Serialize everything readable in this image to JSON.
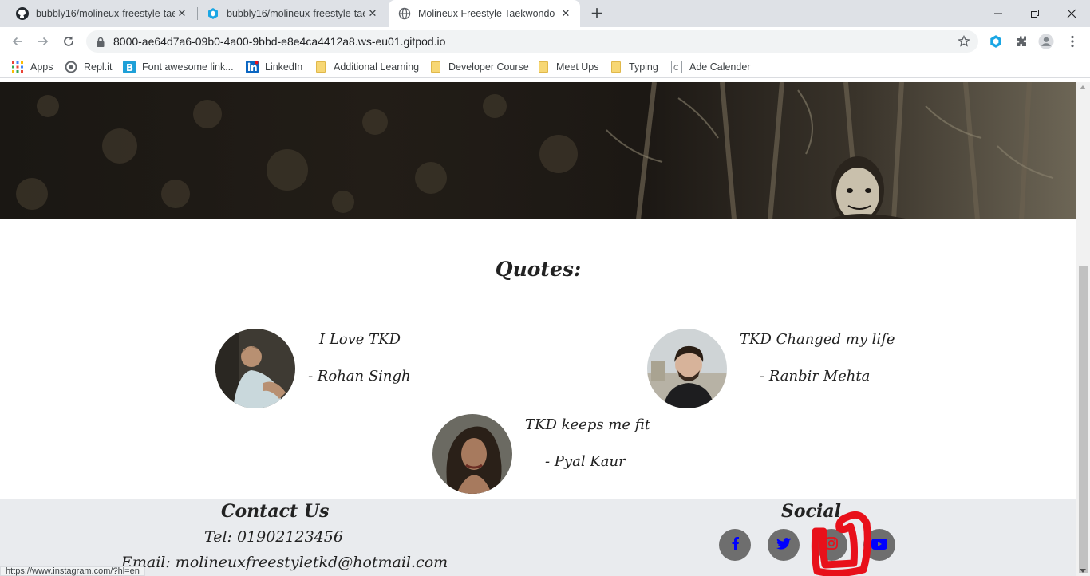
{
  "browser": {
    "tabs": [
      {
        "label": "bubbly16/molineux-freestyle-tae",
        "icon": "github-icon"
      },
      {
        "label": "bubbly16/molineux-freestyle-tae",
        "icon": "gitpod-icon"
      },
      {
        "label": "Molineux Freestyle Taekwondo",
        "icon": "globe-icon",
        "active": true
      }
    ],
    "url": "8000-ae64d7a6-09b0-4a00-9bbd-e8e4ca4412a8.ws-eu01.gitpod.io",
    "bookmarks": [
      {
        "label": "Apps",
        "icon": "apps-grid-icon"
      },
      {
        "label": "Repl.it",
        "icon": "replit-icon"
      },
      {
        "label": "Font awesome link...",
        "icon": "bootstrap-icon"
      },
      {
        "label": "LinkedIn",
        "icon": "linkedin-icon"
      },
      {
        "label": "Additional Learning",
        "icon": "folder-icon"
      },
      {
        "label": "Developer Course",
        "icon": "folder-icon"
      },
      {
        "label": "Meet Ups",
        "icon": "folder-icon"
      },
      {
        "label": "Typing",
        "icon": "folder-icon"
      },
      {
        "label": "Ade Calender",
        "icon": "page-icon"
      }
    ],
    "status_url": "https://www.instagram.com/?hl=en"
  },
  "page": {
    "quotes_title": "Quotes:",
    "quotes": [
      {
        "text": "I Love TKD",
        "author": "- Rohan Singh"
      },
      {
        "text": "TKD Changed my life",
        "author": "- Ranbir Mehta"
      },
      {
        "text": "TKD keeps me fit",
        "author": "- Pyal Kaur"
      }
    ],
    "footer": {
      "contact_title": "Contact Us",
      "tel": "Tel: 01902123456",
      "email": "Email: molineuxfreestyletkd@hotmail.com",
      "social_title": "Social"
    },
    "social_icons": [
      "facebook-icon",
      "twitter-icon",
      "instagram-icon",
      "youtube-icon"
    ]
  },
  "colors": {
    "social_icon_blue": "#0000ff",
    "social_icon_bg": "#6e6e6e",
    "annotation_red": "#e8101a",
    "footer_bg": "#e9ebee"
  }
}
